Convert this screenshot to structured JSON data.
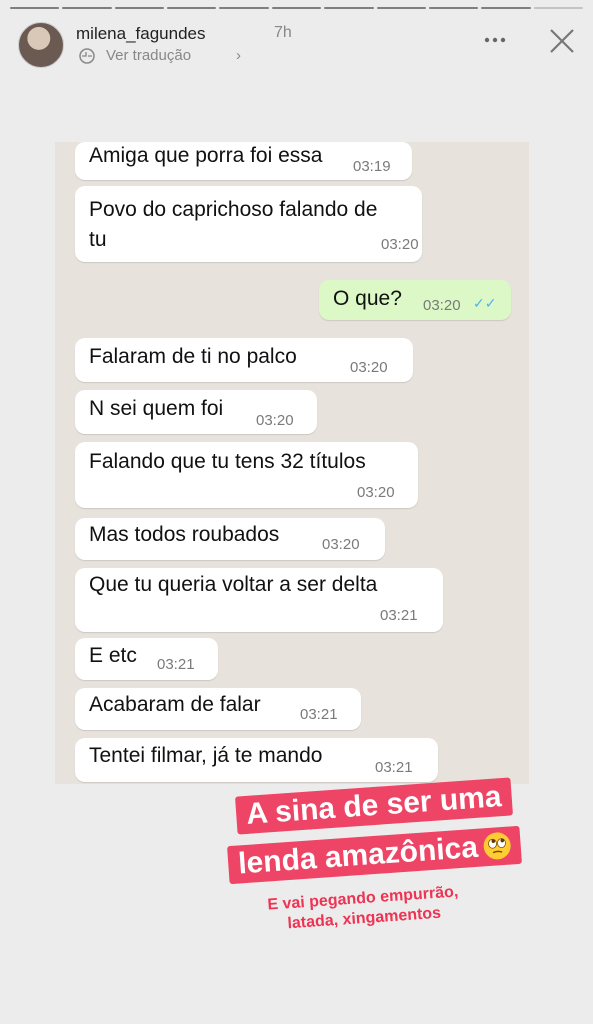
{
  "story": {
    "username": "milena_fagundes",
    "time": "7h",
    "translate_label": "Ver tradução",
    "progress": {
      "segments": 11,
      "completed": 10
    }
  },
  "chat": {
    "messages": [
      {
        "dir": "in",
        "text": "Amiga que porra foi essa",
        "time": "03:19"
      },
      {
        "dir": "in",
        "text": "Povo do caprichoso falando de\ntu",
        "time": "03:20"
      },
      {
        "dir": "out",
        "text": "O que?",
        "time": "03:20",
        "status": "read"
      },
      {
        "dir": "in",
        "text": "Falaram de ti no palco",
        "time": "03:20"
      },
      {
        "dir": "in",
        "text": "N sei quem foi",
        "time": "03:20"
      },
      {
        "dir": "in",
        "text": "Falando que tu tens 32 títulos",
        "time": "03:20"
      },
      {
        "dir": "in",
        "text": "Mas todos roubados",
        "time": "03:20"
      },
      {
        "dir": "in",
        "text": "Que tu queria voltar a ser delta",
        "time": "03:21"
      },
      {
        "dir": "in",
        "text": "E etc",
        "time": "03:21"
      },
      {
        "dir": "in",
        "text": "Acabaram de falar",
        "time": "03:21"
      },
      {
        "dir": "in",
        "text": "Tentei filmar, já te mando",
        "time": "03:21"
      }
    ]
  },
  "sticker": {
    "line1": "A sina de ser uma",
    "line2": "lenda amazônica",
    "emoji": "eye-roll-emoji",
    "caption_line1": "E vai pegando empurrão,",
    "caption_line2": "latada, xingamentos"
  },
  "colors": {
    "sticker": "#ee4465",
    "outgoing": "#dcf8c6",
    "ticks": "#4fb6ec"
  }
}
